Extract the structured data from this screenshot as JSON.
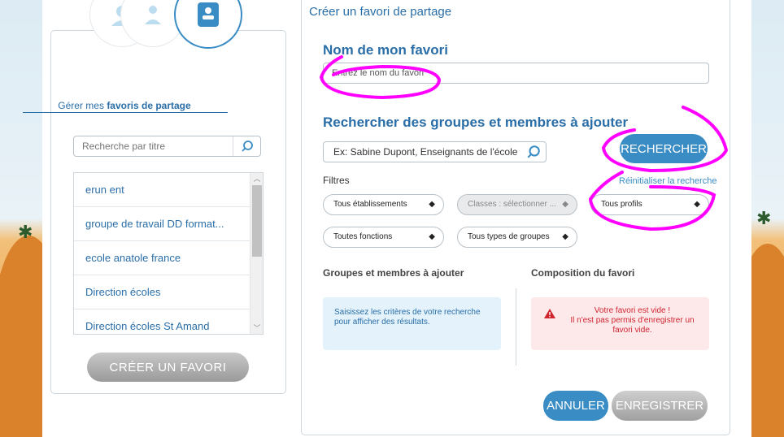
{
  "left_panel": {
    "title_prefix": "Gérer mes ",
    "title_bold": "favoris de partage",
    "search_placeholder": "Recherche par titre",
    "items": [
      {
        "label": "erun ent"
      },
      {
        "label": "groupe de travail DD format..."
      },
      {
        "label": "ecole anatole france"
      },
      {
        "label": "Direction écoles"
      },
      {
        "label": "Direction écoles St Amand"
      }
    ],
    "create_button": "CRÉER UN FAVORI"
  },
  "right_panel": {
    "title": "Créer un favori de partage",
    "name_section": "Nom de mon favori",
    "name_placeholder": "Entrez le nom du favori",
    "search_section": "Rechercher des groupes et membres à ajouter",
    "search_placeholder": "Ex: Sabine Dupont, Enseignants de l'école",
    "search_button": "RECHERCHER",
    "filters_label": "Filtres",
    "reset_link": "Réinitialiser la recherche",
    "filters": {
      "etablissements": "Tous établissements",
      "classes": "Classes : sélectionner ...",
      "profils": "Tous profils",
      "fonctions": "Toutes fonctions",
      "types_groupes": "Tous types de groupes"
    },
    "col_left_title": "Groupes et membres à ajouter",
    "col_right_title": "Composition du favori",
    "info_text": "Saisissez les critères de votre recherche pour afficher des résultats.",
    "warn_line1": "Votre favori est vide !",
    "warn_line2": "Il n'est pas permis d'enregistrer un favori vide.",
    "cancel_button": "ANNULER",
    "save_button": "ENREGISTRER"
  },
  "colors": {
    "accent": "#3a8cc4",
    "title_blue": "#2a6ea8",
    "warning_red": "#d0242f",
    "annotation_magenta": "#ff00ff"
  }
}
